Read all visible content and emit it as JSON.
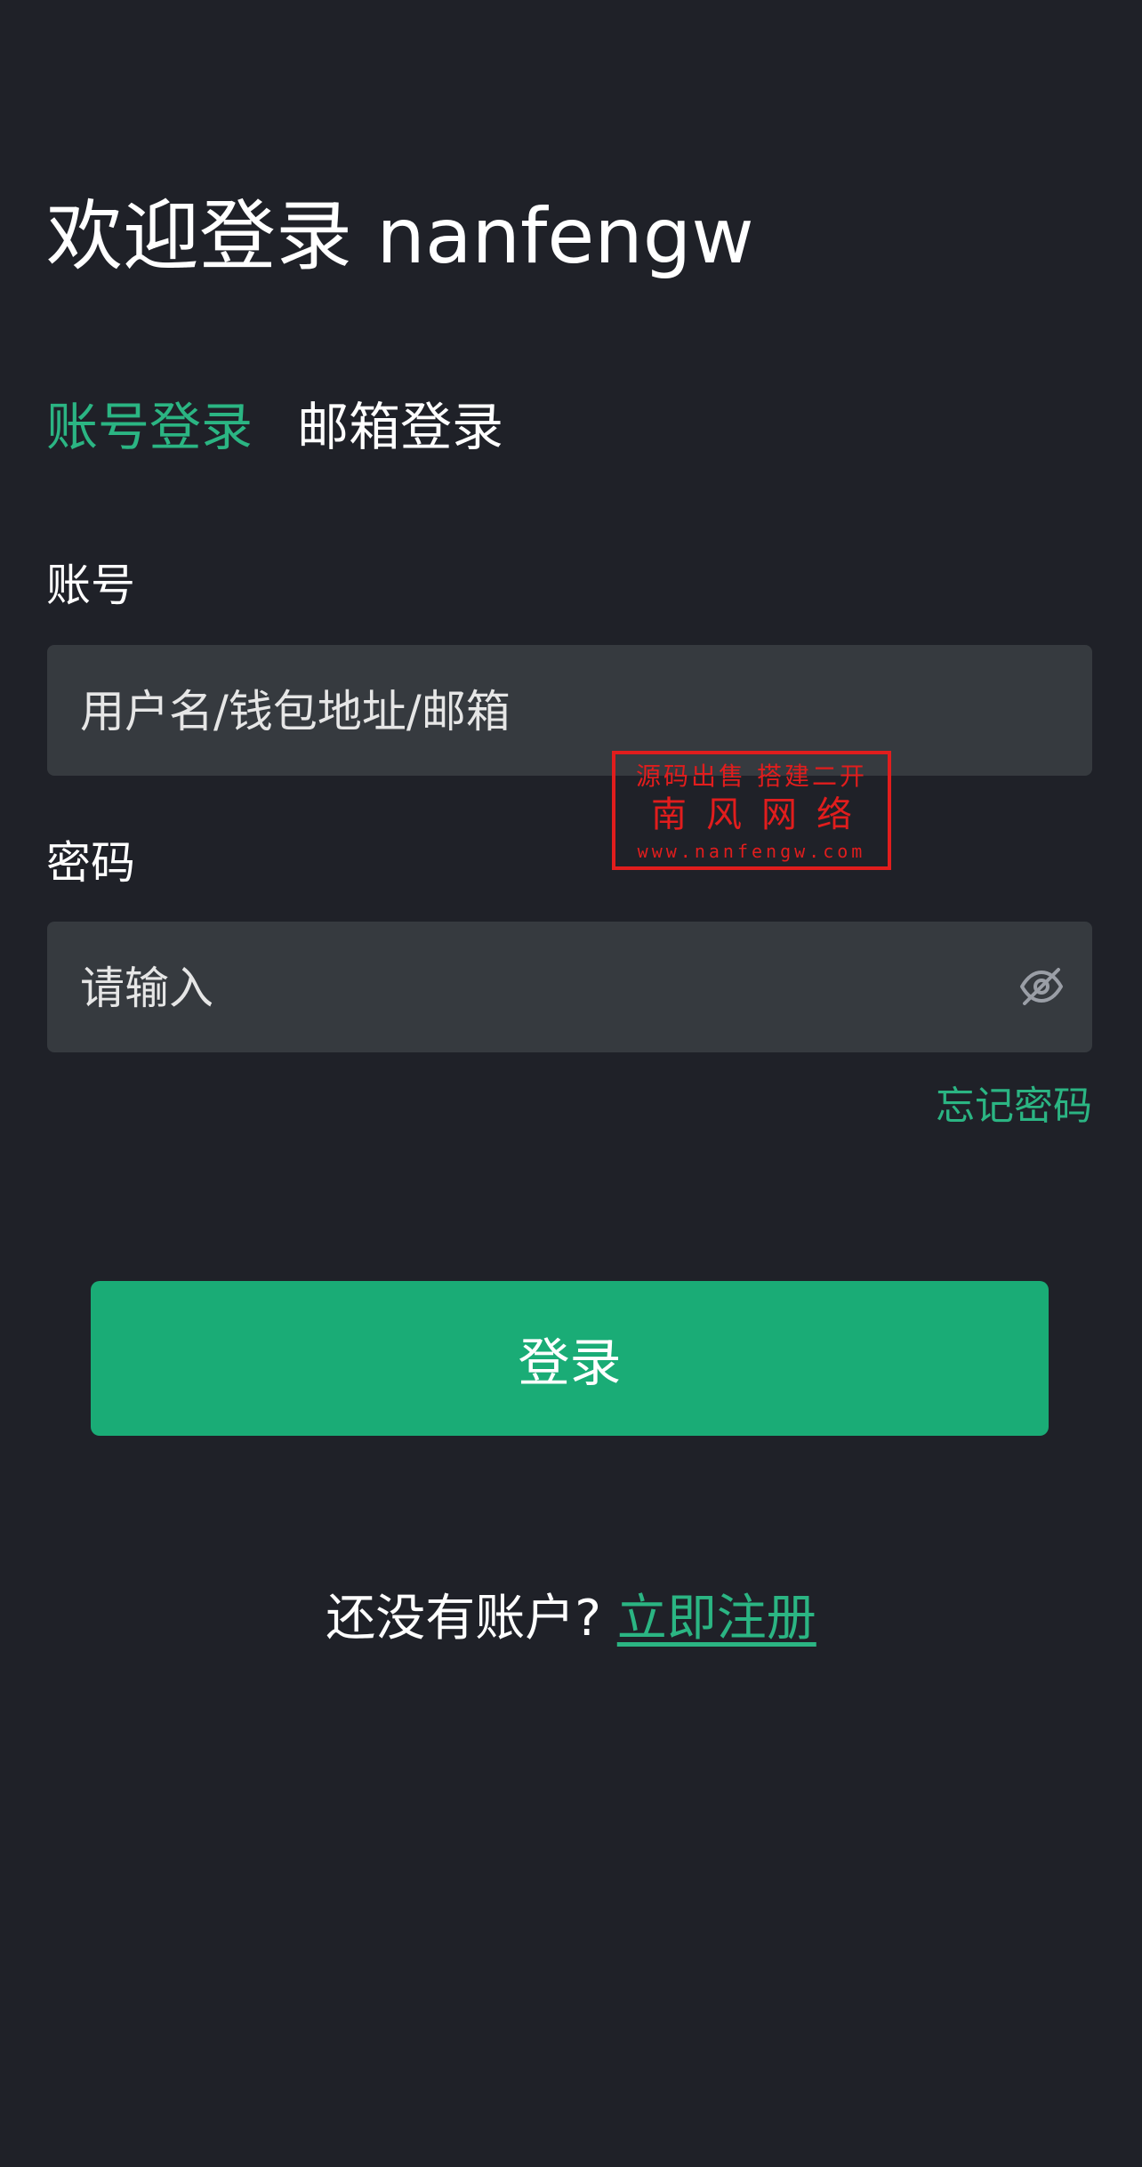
{
  "header": {
    "title": "欢迎登录 nanfengw"
  },
  "tabs": [
    {
      "label": "账号登录",
      "active": true
    },
    {
      "label": "邮箱登录",
      "active": false
    }
  ],
  "form": {
    "account": {
      "label": "账号",
      "placeholder": "用户名/钱包地址/邮箱",
      "value": ""
    },
    "password": {
      "label": "密码",
      "placeholder": "请输入",
      "value": "",
      "toggle_icon": "eye-off-icon"
    },
    "forgot_label": "忘记密码",
    "submit_label": "登录"
  },
  "footer": {
    "prompt": "还没有账户?",
    "register_label": "立即注册"
  },
  "watermark": {
    "line1": "源码出售 搭建二开",
    "line2": "南风网络",
    "line3": "www.nanfengw.com"
  },
  "colors": {
    "background": "#1f2128",
    "accent": "#2bb583",
    "button": "#1aac76",
    "input_background": "#363a3f",
    "watermark": "#e11d1d"
  }
}
